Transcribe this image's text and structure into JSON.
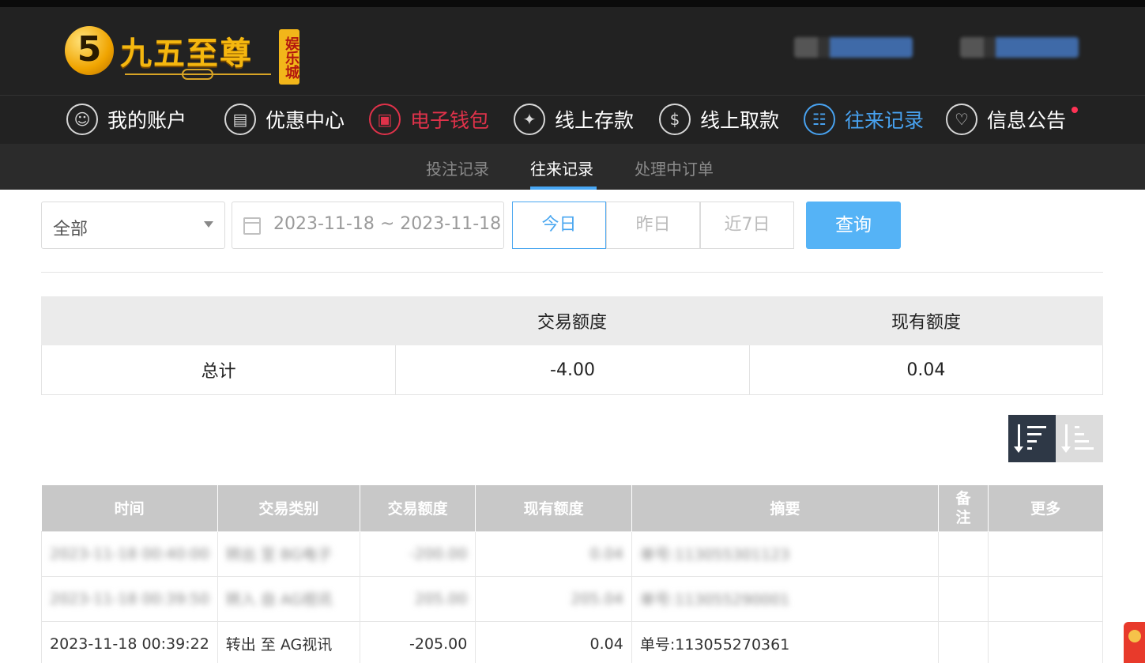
{
  "brand": {
    "name": "九五至尊",
    "badge": "娱乐城",
    "number": "5"
  },
  "nav": [
    {
      "label": "我的账户",
      "icon": "user-icon"
    },
    {
      "label": "优惠中心",
      "icon": "gift-icon"
    },
    {
      "label": "电子钱包",
      "icon": "wallet-icon"
    },
    {
      "label": "线上存款",
      "icon": "deposit-icon"
    },
    {
      "label": "线上取款",
      "icon": "withdraw-icon"
    },
    {
      "label": "往来记录",
      "icon": "records-icon"
    },
    {
      "label": "信息公告",
      "icon": "bell-icon"
    }
  ],
  "subnav": {
    "bet_records": "投注记录",
    "transactions": "往来记录",
    "pending_orders": "处理中订单"
  },
  "filter": {
    "type_value": "全部",
    "date_range": "2023-11-18 ~ 2023-11-18",
    "today": "今日",
    "yesterday": "昨日",
    "last7": "近7日",
    "query": "查询"
  },
  "summary": {
    "headers": [
      "",
      "交易额度",
      "现有额度"
    ],
    "row": {
      "label": "总计",
      "amount": "-4.00",
      "balance": "0.04"
    }
  },
  "table": {
    "headers": [
      "时间",
      "交易类别",
      "交易额度",
      "现有额度",
      "摘要",
      "备注",
      "更多"
    ],
    "rows": [
      {
        "time": "2023-11-18 00:40:00",
        "type": "转出 至 BG电子",
        "amount": "-200.00",
        "balance": "0.04",
        "summary": "单号:113055301123",
        "note": "",
        "more": ""
      },
      {
        "time": "2023-11-18 00:39:50",
        "type": "转入 自 AG视讯",
        "amount": "205.00",
        "balance": "205.04",
        "summary": "单号:113055290001",
        "note": "",
        "more": ""
      },
      {
        "time": "2023-11-18 00:39:22",
        "type": "转出 至 AG视讯",
        "amount": "-205.00",
        "balance": "0.04",
        "summary": "单号:113055270361",
        "note": "",
        "more": ""
      }
    ]
  },
  "colors": {
    "accent_blue": "#48a2f0",
    "accent_red": "#e0324a",
    "header_bg": "#222222",
    "query_btn": "#55b3f6"
  }
}
